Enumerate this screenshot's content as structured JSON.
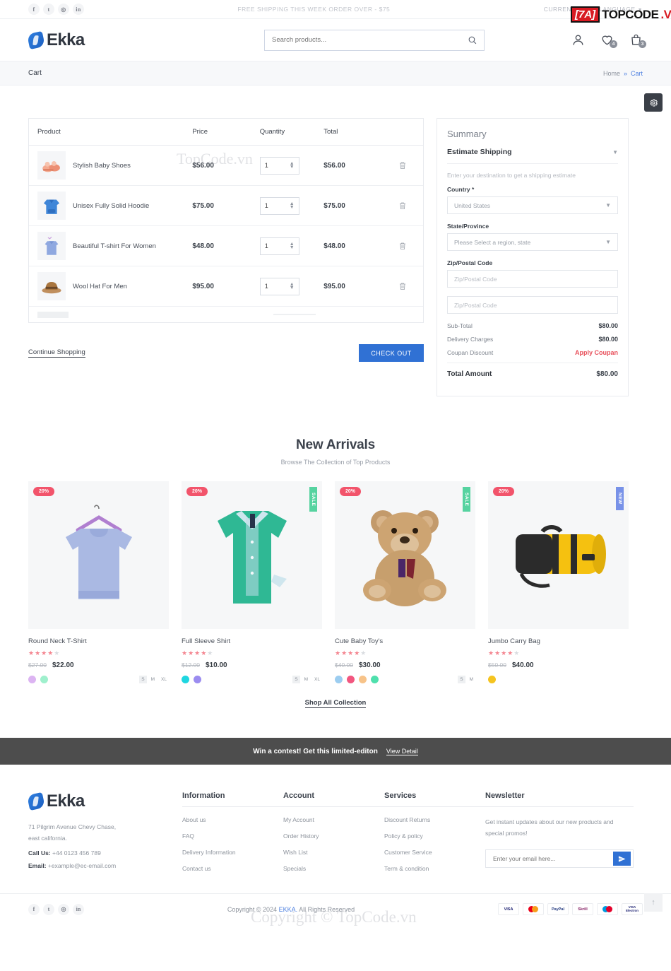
{
  "topbar": {
    "social": [
      "f",
      "t",
      "in-g",
      "in"
    ],
    "promo": "FREE SHIPPING THIS WEEK ORDER OVER - $75",
    "currency": "CURRENCY",
    "language": "LANGUAGE"
  },
  "header": {
    "logo_text": "Ekka",
    "search_placeholder": "Search products...",
    "wishlist_count": "4",
    "cart_count": "3"
  },
  "breadcrumb": {
    "title": "Cart",
    "home": "Home",
    "separator": "»",
    "current": "Cart"
  },
  "cart": {
    "columns": {
      "product": "Product",
      "price": "Price",
      "quantity": "Quantity",
      "total": "Total"
    },
    "rows": [
      {
        "name": "Stylish Baby Shoes",
        "price": "$56.00",
        "qty": "1",
        "total": "$56.00",
        "icon": "baby-shoes"
      },
      {
        "name": "Unisex Fully Solid Hoodie",
        "price": "$75.00",
        "qty": "1",
        "total": "$75.00",
        "icon": "hoodie"
      },
      {
        "name": "Beautiful T-shirt For Women",
        "price": "$48.00",
        "qty": "1",
        "total": "$48.00",
        "icon": "tshirt-women"
      },
      {
        "name": "Wool Hat For Men",
        "price": "$95.00",
        "qty": "1",
        "total": "$95.00",
        "icon": "wool-hat"
      }
    ],
    "continue_shopping": "Continue Shopping",
    "checkout": "CHECK OUT"
  },
  "summary": {
    "title": "Summary",
    "estimate_shipping": "Estimate Shipping",
    "estimate_desc": "Enter your destination to get a shipping estimate",
    "country_label": "Country *",
    "country_value": "United States",
    "state_label": "State/Province",
    "state_value": "Please Select a region, state",
    "zip_label": "Zip/Postal Code",
    "zip_placeholder": "Zip/Postal Code",
    "zip_placeholder2": "Zip/Postal Code",
    "subtotal_label": "Sub-Total",
    "subtotal_value": "$80.00",
    "delivery_label": "Delivery Charges",
    "delivery_value": "$80.00",
    "coupon_label": "Coupan Discount",
    "coupon_action": "Apply Coupan",
    "total_label": "Total Amount",
    "total_value": "$80.00",
    "coupon_color": "#e8505b"
  },
  "arrivals": {
    "title": "New Arrivals",
    "subtitle": "Browse The Collection of Top Products",
    "shop_all": "Shop All Collection",
    "products": [
      {
        "name": "Round Neck T-Shirt",
        "discount": "20%",
        "tag": "",
        "old_price": "$27.00",
        "price": "$22.00",
        "stars_filled": 4,
        "swatches": [
          "#dcb4f2",
          "#9ff0cd"
        ],
        "sizes": [
          "S",
          "M",
          "XL"
        ],
        "active_size": "S",
        "image": "sweatshirt"
      },
      {
        "name": "Full Sleeve Shirt",
        "discount": "20%",
        "tag": "SALE",
        "old_price": "$12.00",
        "price": "$10.00",
        "stars_filled": 4,
        "swatches": [
          "#1fd6e0",
          "#9b8cf0"
        ],
        "sizes": [
          "S",
          "M",
          "XL"
        ],
        "active_size": "S",
        "image": "green-shirt"
      },
      {
        "name": "Cute Baby Toy's",
        "discount": "20%",
        "tag": "SALE",
        "old_price": "$40.00",
        "price": "$30.00",
        "stars_filled": 4,
        "swatches": [
          "#9ccdf0",
          "#f2567f",
          "#f7c389",
          "#4fe0ad"
        ],
        "sizes": [
          "S",
          "M"
        ],
        "active_size": "S",
        "image": "teddy-bear"
      },
      {
        "name": "Jumbo Carry Bag",
        "discount": "20%",
        "tag": "NEW",
        "old_price": "$50.00",
        "price": "$40.00",
        "stars_filled": 4,
        "swatches": [
          "#f5c420"
        ],
        "sizes": [],
        "active_size": "",
        "image": "yellow-bag"
      }
    ]
  },
  "contest": {
    "text": "Win a contest! Get this limited-editon",
    "link": "View Detail"
  },
  "footer": {
    "logo_text": "Ekka",
    "address_line1": "71 Pilgrim Avenue Chevy Chase,",
    "address_line2": "east california.",
    "call_label": "Call Us:",
    "call_value": "+44 0123 456 789",
    "email_label": "Email:",
    "email_value": "+example@ec-email.com",
    "columns": [
      {
        "heading": "Information",
        "items": [
          "About us",
          "FAQ",
          "Delivery Information",
          "Contact us"
        ]
      },
      {
        "heading": "Account",
        "items": [
          "My Account",
          "Order History",
          "Wish List",
          "Specials"
        ]
      },
      {
        "heading": "Services",
        "items": [
          "Discount Returns",
          "Policy & policy",
          "Customer Service",
          "Term & condition"
        ]
      }
    ],
    "newsletter": {
      "heading": "Newsletter",
      "desc": "Get instant updates about our new products and special promos!",
      "placeholder": "Enter your email here..."
    },
    "copyright_pre": "Copyright © 2024",
    "copyright_brand": "EKKA.",
    "copyright_post": "All Rights Reserved",
    "payments": [
      "VISA",
      "Mastercard",
      "PayPal",
      "Skrill",
      "Maestro",
      "Visa Electron"
    ]
  },
  "watermarks": {
    "topcode_small": "TopCode.vn",
    "copyright_big": "Copyright © TopCode.vn",
    "logo_box": "[7A]",
    "logo_t1": "TOPCODE",
    "logo_t2": ".VN"
  }
}
